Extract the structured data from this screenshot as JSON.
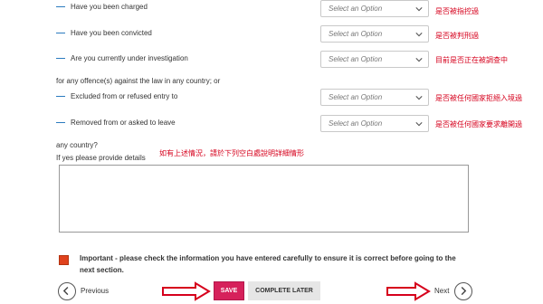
{
  "questions": [
    {
      "label": "Have you been charged",
      "placeholder": "Select an Option",
      "note": "是否被指控過"
    },
    {
      "label": "Have you been convicted",
      "placeholder": "Select an Option",
      "note": "是否被判刑過"
    },
    {
      "label": "Are you currently under investigation",
      "placeholder": "Select an Option",
      "note": "目前是否正在被調查中"
    },
    {
      "label": "Excluded from or refused entry to",
      "placeholder": "Select an Option",
      "note": "是否被任何國家拒絕入境過"
    },
    {
      "label": "Removed from or asked to leave",
      "placeholder": "Select an Option",
      "note": "是否被任何國家要求離開過"
    }
  ],
  "text": {
    "offences_intro": "for any offence(s) against the law in any country; or",
    "any_country": "any country?",
    "if_yes": "If yes please provide details",
    "details_note": "如有上述情況，請於下列空白處說明詳細情形",
    "important": "Important - please check the information you have entered carefully to ensure it is correct before going to the next section."
  },
  "buttons": {
    "previous": "Previous",
    "save": "SAVE",
    "complete_later": "COMPLETE LATER",
    "next": "Next"
  },
  "colors": {
    "accent": "#d6215b",
    "annotation": "#d6001c",
    "dash": "#2b7bbf"
  }
}
